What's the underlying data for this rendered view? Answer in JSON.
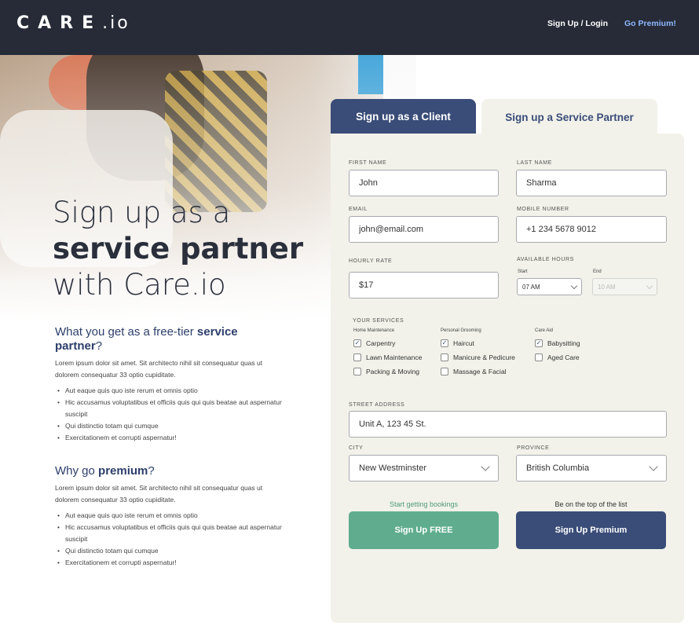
{
  "header": {
    "logo_main": "CARE",
    "logo_suffix": ".io",
    "login_label": "Sign Up / Login",
    "premium_label": "Go Premium!"
  },
  "hero": {
    "line1": "Sign up as a",
    "line2": "service partner",
    "line3": "with Care.io"
  },
  "info_free": {
    "title_pre": "What you get as a free-tier ",
    "title_bold": "service partner",
    "title_post": "?",
    "paragraph": "Lorem ipsum dolor sit amet. Sit architecto nihil sit consequatur quas ut dolorem consequatur 33 optio cupiditate.",
    "bullets": [
      "Aut eaque quis quo iste rerum et omnis optio",
      "Hic accusamus voluptatibus et officiis quis qui quis beatae aut aspernatur suscipit",
      "Qui distinctio totam qui cumque",
      "Exercitationem et corrupti aspernatur!"
    ]
  },
  "info_premium": {
    "title_pre": "Why go ",
    "title_bold": "premium",
    "title_post": "?",
    "paragraph": "Lorem ipsum dolor sit amet. Sit architecto nihil sit consequatur quas ut dolorem consequatur 33 optio cupiditate.",
    "bullets": [
      "Aut eaque quis quo iste rerum et omnis optio",
      "Hic accusamus voluptatibus et officiis quis qui quis beatae aut aspernatur suscipit",
      "Qui distinctio totam qui cumque",
      "Exercitationem et corrupti aspernatur!"
    ]
  },
  "tabs": {
    "client": "Sign up as a Client",
    "partner": "Sign up a Service Partner"
  },
  "form": {
    "first_name": {
      "label": "First Name",
      "value": "John"
    },
    "last_name": {
      "label": "Last Name",
      "value": "Sharma"
    },
    "email": {
      "label": "Email",
      "value": "john@email.com"
    },
    "mobile": {
      "label": "Mobile Number",
      "value": "+1 234 5678 9012"
    },
    "hourly_rate": {
      "label": "Hourly Rate",
      "value": "$17"
    },
    "hours": {
      "label": "Available Hours",
      "start_label": "Start",
      "start_value": "07 AM",
      "end_label": "End",
      "end_value": "10 AM"
    },
    "services": {
      "label": "Your Services",
      "groups": [
        {
          "heading": "Home Maintenance",
          "items": [
            {
              "label": "Carpentry",
              "checked": true
            },
            {
              "label": "Lawn Maintenance",
              "checked": false
            },
            {
              "label": "Packing & Moving",
              "checked": false
            }
          ]
        },
        {
          "heading": "Personal Grooming",
          "items": [
            {
              "label": "Haircut",
              "checked": true
            },
            {
              "label": "Manicure & Pedicure",
              "checked": false
            },
            {
              "label": "Massage & Facial",
              "checked": false
            }
          ]
        },
        {
          "heading": "Care Aid",
          "items": [
            {
              "label": "Babysitting",
              "checked": true
            },
            {
              "label": "Aged Care",
              "checked": false
            }
          ]
        }
      ]
    },
    "street": {
      "label": "Street Address",
      "value": "Unit A, 123 45 St."
    },
    "city": {
      "label": "City",
      "value": "New Westminster"
    },
    "province": {
      "label": "Province",
      "value": "British Columbia"
    },
    "free_caption": "Start getting bookings",
    "free_button": "Sign Up FREE",
    "premium_caption": "Be on the top of the list",
    "premium_button": "Sign Up Premium"
  },
  "colors": {
    "header_bg": "#262b37",
    "primary_navy": "#3a4d78",
    "accent_green": "#5fad8e",
    "panel_bg": "#f2f2ea",
    "premium_link": "#8fb7ff"
  }
}
